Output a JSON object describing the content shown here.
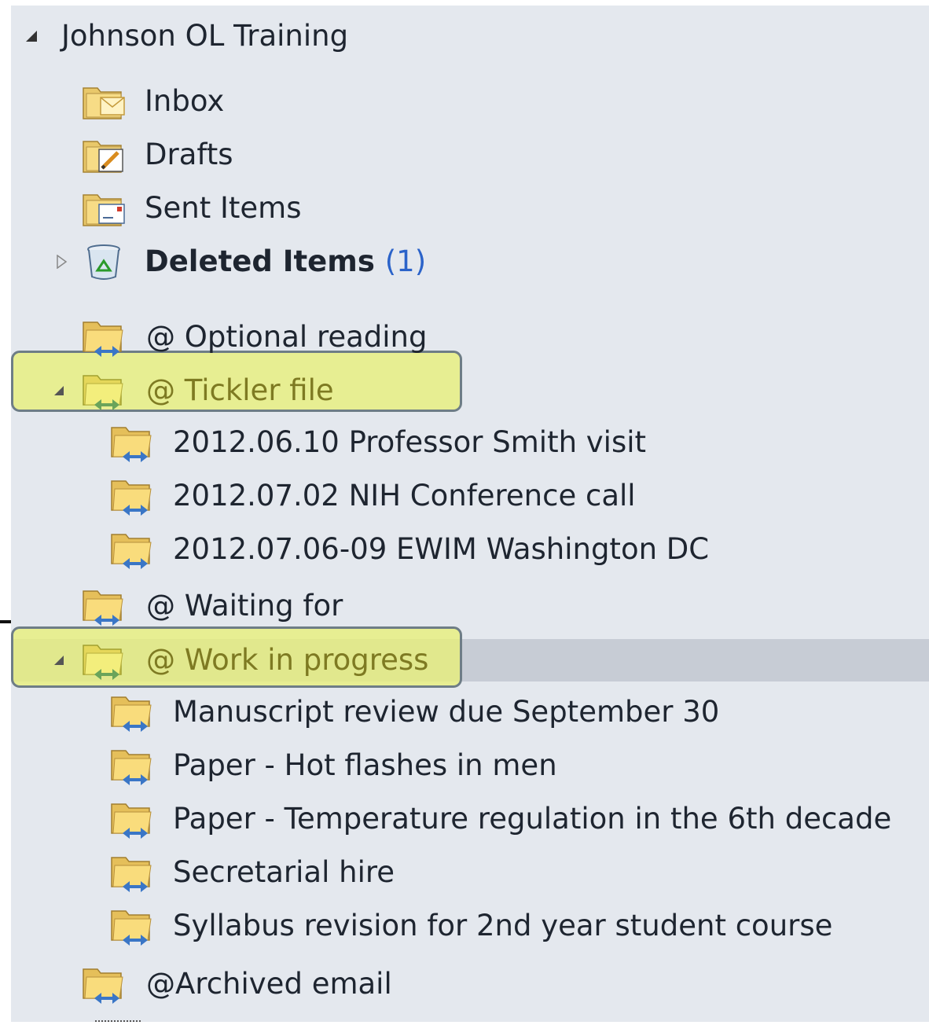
{
  "account": {
    "name": "Johnson OL Training"
  },
  "folders": {
    "inbox": "Inbox",
    "drafts": "Drafts",
    "sent": "Sent Items",
    "deleted": {
      "label": "Deleted Items",
      "count": "(1)"
    },
    "optional_reading": "@ Optional reading",
    "tickler": {
      "label": "@ Tickler file",
      "children": [
        "2012.06.10  Professor Smith visit",
        "2012.07.02  NIH Conference call",
        "2012.07.06-09  EWIM Washington DC"
      ]
    },
    "waiting_for": "@ Waiting for",
    "work_in_progress": {
      "label": "@ Work in progress",
      "children": [
        "Manuscript review due September 30",
        "Paper -  Hot flashes in men",
        "Paper -  Temperature regulation in the 6th decade",
        "Secretarial hire",
        "Syllabus revision for 2nd year student course"
      ]
    },
    "archived": "@Archived email"
  },
  "colors": {
    "pane_bg": "#e4e8ee",
    "selected_bg": "#c7ccd5",
    "highlight": "#e8f078",
    "unread_count": "#2b63c9"
  }
}
